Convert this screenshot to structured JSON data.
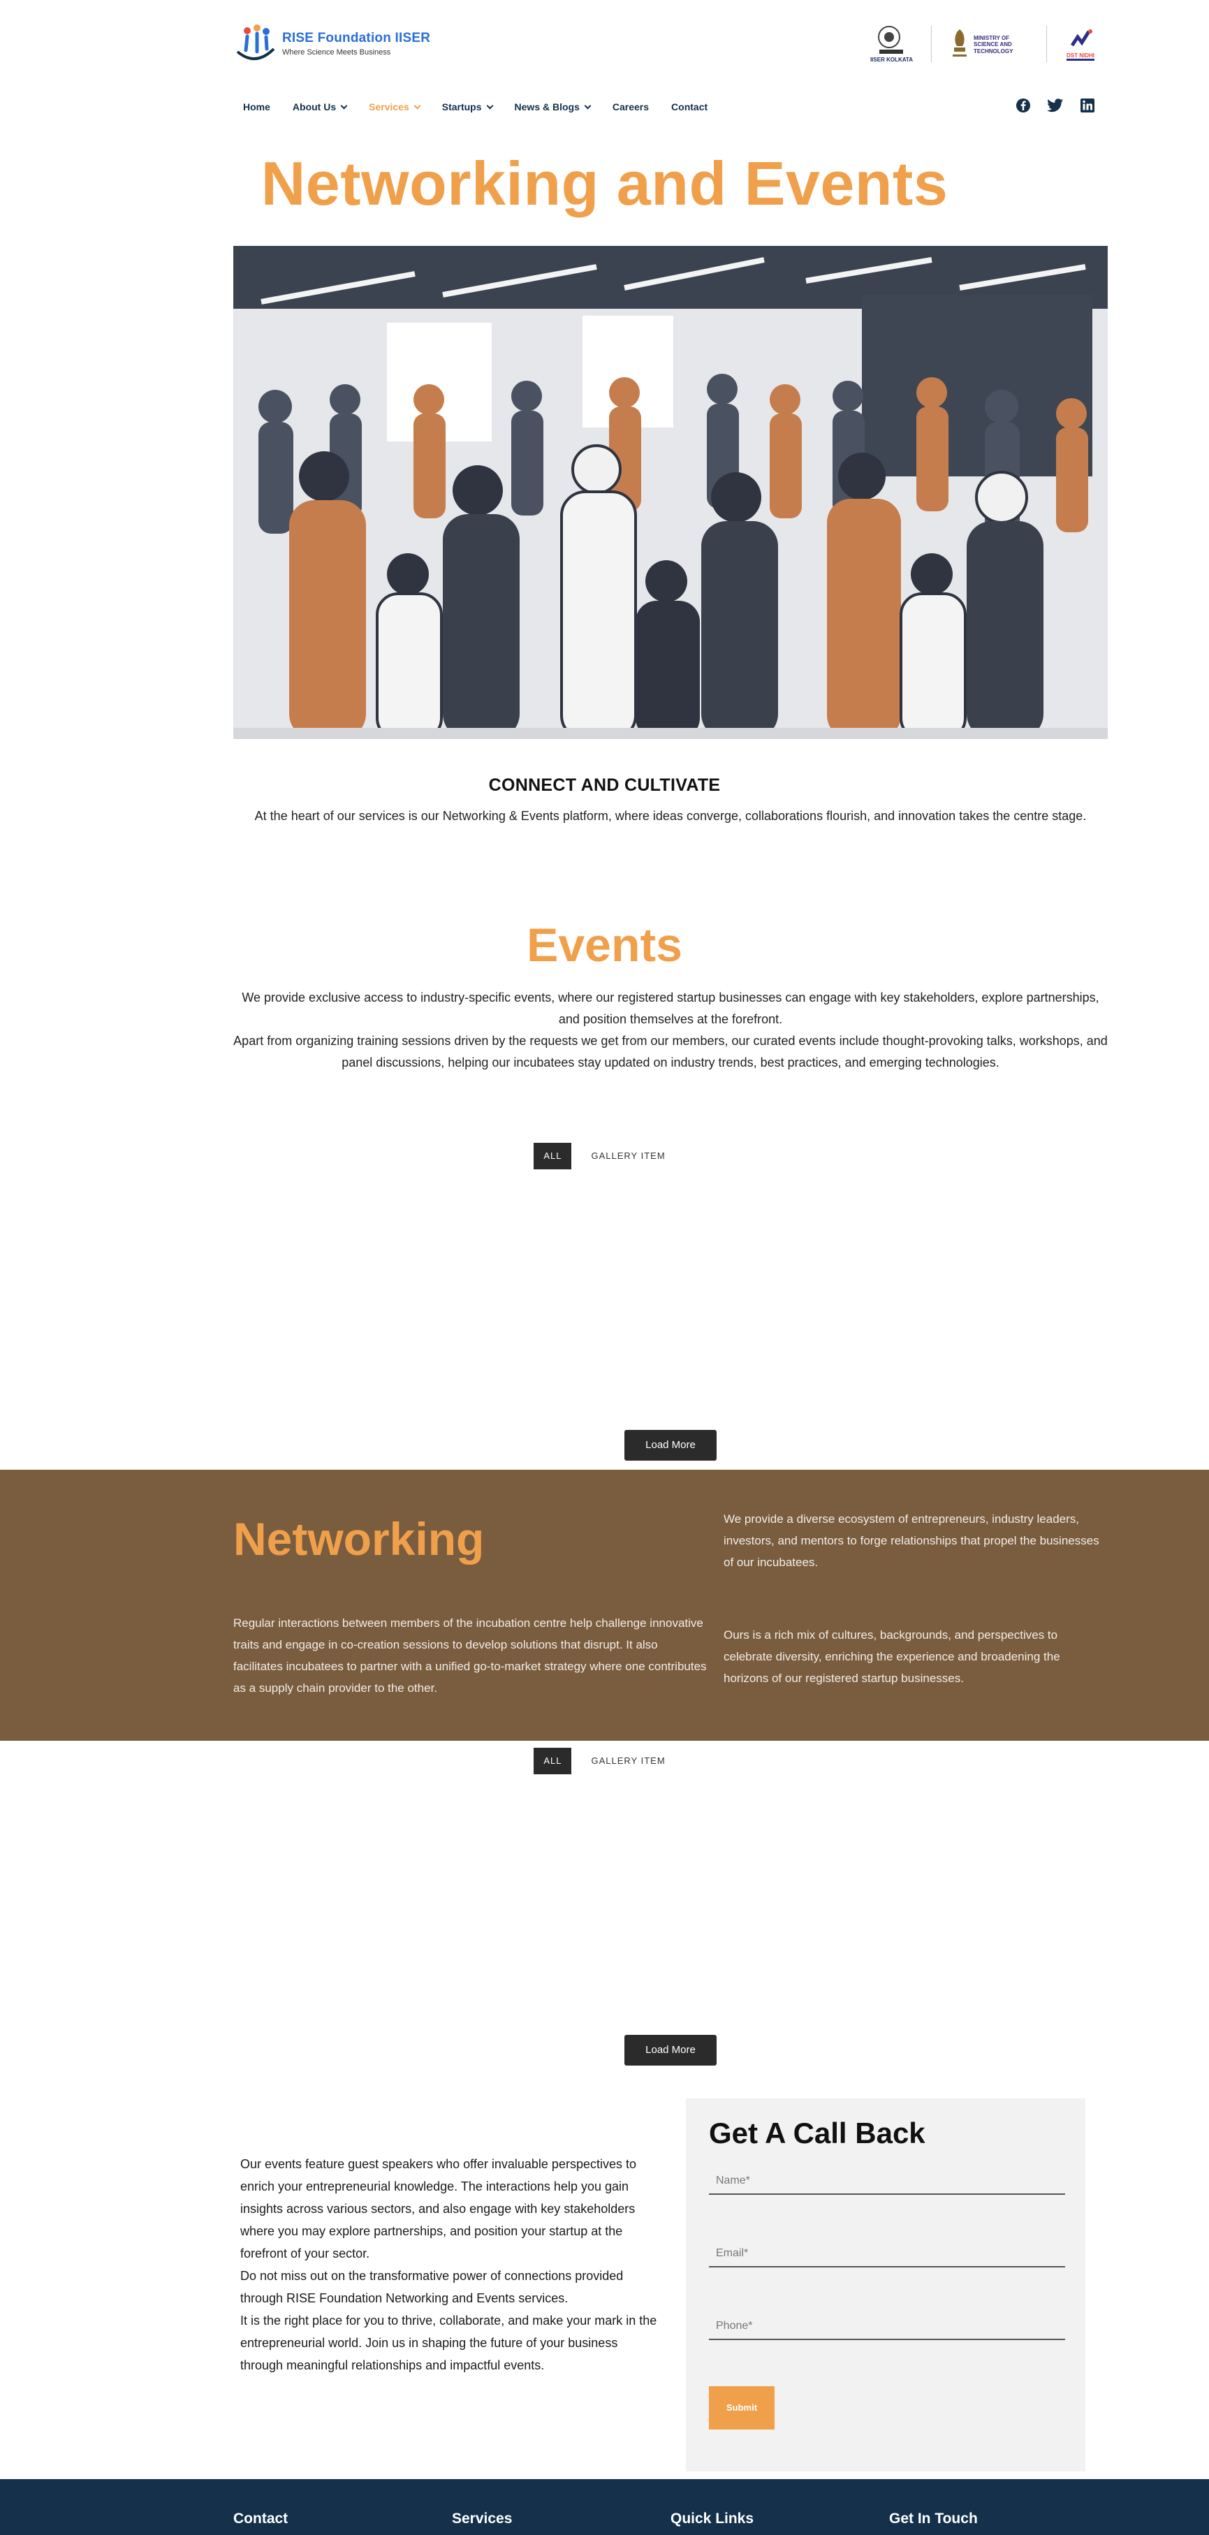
{
  "brand": {
    "title": "RISE Foundation IISER",
    "tagline": "Where Science Meets Business",
    "accent": "#f0a04b",
    "dark_band": "#7a5d3f",
    "footer_bg": "#14304a"
  },
  "partners": [
    {
      "label": "IISER KOLKATA",
      "icon": "iiser-seal-icon"
    },
    {
      "label": "MINISTRY OF SCIENCE AND TECHNOLOGY",
      "icon": "emblem-icon"
    },
    {
      "label": "DST NIDHI",
      "icon": "dst-nidhi-icon"
    }
  ],
  "nav": {
    "items": [
      {
        "label": "Home",
        "dropdown": false
      },
      {
        "label": "About Us",
        "dropdown": true
      },
      {
        "label": "Services",
        "dropdown": true,
        "active": true
      },
      {
        "label": "Startups",
        "dropdown": true
      },
      {
        "label": "News & Blogs",
        "dropdown": true
      },
      {
        "label": "Careers",
        "dropdown": false
      },
      {
        "label": "Contact",
        "dropdown": false
      }
    ],
    "socials": [
      "facebook-icon",
      "twitter-icon",
      "linkedin-icon"
    ]
  },
  "hero": {
    "title": "Networking and Events"
  },
  "connect": {
    "heading": "CONNECT AND CULTIVATE",
    "text": "At the heart of our services is our Networking & Events platform, where ideas converge, collaborations flourish, and innovation takes the centre stage."
  },
  "events": {
    "title": "Events",
    "p1": "We provide exclusive access to industry-specific events, where our registered startup businesses can engage with key stakeholders, explore partnerships, and position themselves at the forefront.",
    "p2": "Apart from organizing training sessions driven by the requests we get from our members, our curated events include thought-provoking talks, workshops, and panel discussions, helping our incubatees stay updated on industry trends, best practices, and emerging technologies."
  },
  "gallery1": {
    "filter_all": "ALL",
    "filter_item": "GALLERY ITEM",
    "load_more": "Load More"
  },
  "networking": {
    "title": "Networking",
    "left": "Regular interactions between members of the incubation centre help challenge innovative traits and engage in co-creation sessions to develop solutions that disrupt. It also facilitates incubatees to partner with a unified go-to-market strategy where one contributes as a supply chain provider to the other.",
    "right1": "We provide a diverse ecosystem of entrepreneurs, industry leaders, investors, and mentors to forge relationships that propel the businesses of our incubatees.",
    "right2": "Ours is a rich mix of cultures, backgrounds, and perspectives to celebrate diversity, enriching the experience and broadening the horizons of our registered startup businesses."
  },
  "gallery2": {
    "filter_all": "ALL",
    "filter_item": "GALLERY ITEM",
    "load_more": "Load More"
  },
  "closing": {
    "p1": "Our events feature guest speakers who offer invaluable perspectives to enrich your entrepreneurial knowledge. The interactions help you gain insights across various sectors, and also engage with key stakeholders where you may explore partnerships, and position your startup at the forefront of your sector.",
    "p2": "Do not miss out on the transformative power of connections provided through RISE Foundation Networking and Events services.",
    "p3": "It is the right place for you to thrive, collaborate, and make your mark in the entrepreneurial world. Join us in shaping the future of your business through meaningful relationships and impactful events."
  },
  "callback": {
    "title": "Get A Call Back",
    "name_placeholder": "Name*",
    "email_placeholder": "Email*",
    "phone_placeholder": "Phone*",
    "submit": "Submit"
  },
  "footer": {
    "columns": [
      "Contact",
      "Services",
      "Quick Links",
      "Get In Touch"
    ]
  }
}
